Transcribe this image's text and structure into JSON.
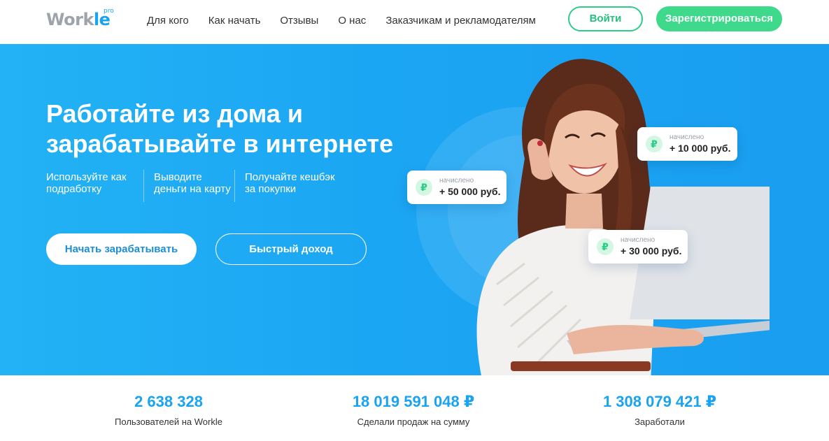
{
  "header": {
    "logo": {
      "part1": "Work",
      "part2": "le",
      "sup": "pro"
    },
    "nav": [
      "Для кого",
      "Как начать",
      "Отзывы",
      "О нас",
      "Заказчикам и рекламодателям"
    ],
    "login_label": "Войти",
    "register_label": "Зарегистрироваться"
  },
  "hero": {
    "title_line1": "Работайте из дома и",
    "title_line2": "зарабатывайте в интернете",
    "features": [
      {
        "line1": "Используйте как",
        "line2": "подработку"
      },
      {
        "line1": "Выводите",
        "line2": "деньги на карту"
      },
      {
        "line1": "Получайте кешбэк",
        "line2": "за покупки"
      }
    ],
    "start_button": "Начать зарабатывать",
    "quick_button": "Быстрый доход",
    "cards": [
      {
        "coin": "₽",
        "label": "начислено",
        "amount": "+ 50 000 руб."
      },
      {
        "coin": "₽",
        "label": "начислено",
        "amount": "+ 10 000 руб."
      },
      {
        "coin": "₽",
        "label": "начислено",
        "amount": "+ 30 000 руб."
      }
    ]
  },
  "stats": [
    {
      "value": "2 638 328",
      "caption": "Пользователей на Workle"
    },
    {
      "value": "18 019 591 048 ₽",
      "caption": "Сделали продаж на сумму"
    },
    {
      "value": "1 308 079 421 ₽",
      "caption": "Заработали"
    }
  ],
  "colors": {
    "accent_blue": "#1aa3f0",
    "accent_green": "#3ed98a",
    "hero_bg": "#1ba6f3"
  }
}
